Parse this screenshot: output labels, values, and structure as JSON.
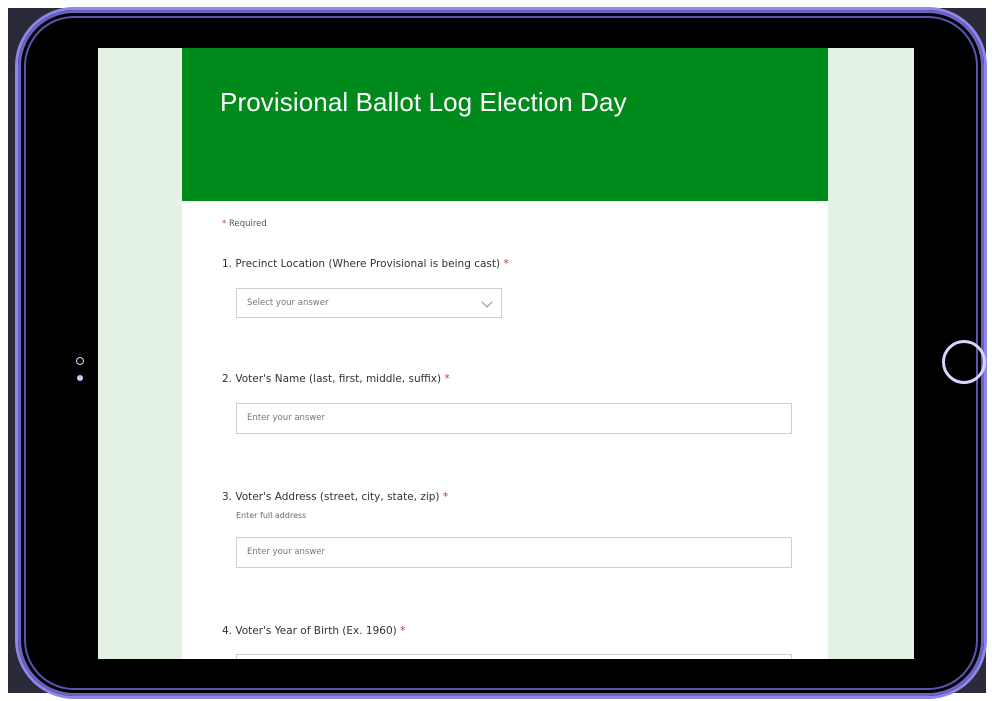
{
  "form": {
    "title": "Provisional Ballot Log Election Day",
    "required_note": "Required",
    "required_marker": "*"
  },
  "questions": [
    {
      "label": "1. Precinct Location (Where Provisional is being cast)",
      "type": "dropdown",
      "placeholder": "Select your answer"
    },
    {
      "label": "2. Voter's Name (last, first, middle, suffix)",
      "type": "text",
      "placeholder": "Enter your answer"
    },
    {
      "label": "3. Voter's Address (street, city, state, zip)",
      "subtitle": "Enter full address",
      "type": "text",
      "placeholder": "Enter your answer"
    },
    {
      "label": "4. Voter's Year of Birth (Ex. 1960)",
      "type": "text",
      "placeholder": ""
    }
  ],
  "colors": {
    "banner": "#008a1c",
    "page_background": "#e3f2e4",
    "required": "#c0392b",
    "device_frame": "#8f86e6"
  },
  "icons": {
    "dropdown": "chevron-down-icon",
    "home": "home-button-icon"
  }
}
